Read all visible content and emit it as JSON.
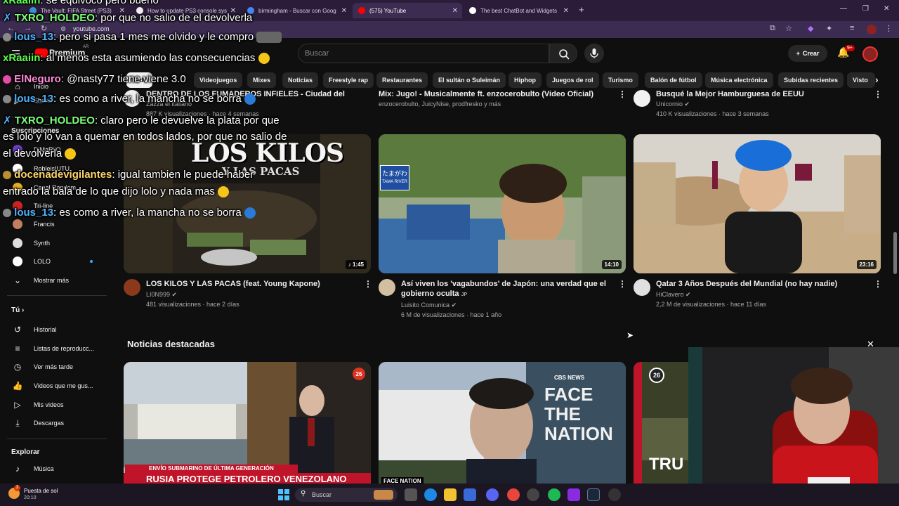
{
  "browser": {
    "tabs": [
      {
        "label": "The Vault: FIFA Street (PS3)",
        "color": "#3a8fd9"
      },
      {
        "label": "How to update PS3 console sys",
        "color": "#eeeeee"
      },
      {
        "label": "birmingham - Buscar con Goog",
        "color": "#4285f4"
      },
      {
        "label": "(575) YouTube",
        "color": "#ff0000"
      },
      {
        "label": "The best ChatBot and Widgets",
        "color": "#ffffff"
      }
    ],
    "new_tab": "+",
    "url": "youtube.com"
  },
  "youtube": {
    "logo_label": "Premium",
    "logo_region": "AR",
    "search_placeholder": "Buscar",
    "create_label": "Crear",
    "notif_count": "9+",
    "chips": [
      "Todo",
      "Videojuegos",
      "Mixes",
      "Noticias",
      "Freestyle rap",
      "Restaurantes",
      "El sultán o Suleimán",
      "Hiphop",
      "Juegos de rol",
      "Turismo",
      "Balón de fútbol",
      "Música electrónica",
      "Subidas recientes",
      "Visto"
    ]
  },
  "sidebar": {
    "top_items": [
      {
        "label": "Inicio",
        "icon": "home-icon"
      },
      {
        "label": "Shorts",
        "icon": "shorts-icon"
      }
    ],
    "subs_title": "Suscripciones",
    "subscriptions": [
      {
        "label": "DjMaRiiO",
        "color": "#6a3fbf"
      },
      {
        "label": "RobleisIUTU",
        "color": "#ffffff"
      },
      {
        "label": "Canal Random",
        "color": "#e0b020"
      },
      {
        "label": "Tri-line",
        "color": "#cc2222"
      },
      {
        "label": "Francis",
        "color": "#c08060"
      },
      {
        "label": "Synth",
        "color": "#dddddd"
      },
      {
        "label": "LOLO",
        "color": "#ffffff"
      }
    ],
    "show_more": "Mostrar más",
    "you_title": "Tú",
    "you_items": [
      {
        "label": "Historial",
        "icon": "history-icon"
      },
      {
        "label": "Listas de reproducc...",
        "icon": "playlist-icon"
      },
      {
        "label": "Ver más tarde",
        "icon": "clock-icon"
      },
      {
        "label": "Videos que me gus...",
        "icon": "like-icon"
      },
      {
        "label": "Mis videos",
        "icon": "video-icon"
      },
      {
        "label": "Descargas",
        "icon": "download-icon"
      }
    ],
    "explore_title": "Explorar",
    "explore_items": [
      {
        "label": "Música",
        "icon": "music-icon"
      }
    ]
  },
  "top_row": [
    {
      "title": "DENTRO DE LOS FUMADEROS INFIELES - Ciudad del Cabo ZA",
      "meta1": "Zazza el italiano",
      "meta2": "887 K visualizaciones · hace 4 semanas"
    },
    {
      "title": "Mix: Jugo! - Musicalmente ft. enzocerobulto (Video Oficial)",
      "meta1": "enzocerobulto, JuicyNise, prodfresko y más",
      "meta2": ""
    },
    {
      "title": "Busqué la Mejor Hamburguesa de EEUU",
      "meta1": "Unicornio",
      "meta2": "410 K visualizaciones · hace 3 semanas"
    }
  ],
  "videos": [
    {
      "title": "LOS KILOS Y LAS PACAS (feat. Young Kapone)",
      "channel": "LI0N999",
      "stats": "481 visualizaciones · hace 2 días",
      "duration": "1:45",
      "thumb_text": "LOS KILOS",
      "thumb_sub": "Y LAS PACAS",
      "avatar_color": "#8a3a1a"
    },
    {
      "title": "Así viven los 'vagabundos' de Japón: una verdad que el gobierno oculta",
      "title_tag": "JP",
      "channel": "Luisito Comunica",
      "stats": "6 M de visualizaciones · hace 1 año",
      "duration": "14:10",
      "sign_text": "たまがわ",
      "sign_sub": "TAMA RIVER",
      "avatar_color": "#d0c0a0"
    },
    {
      "title": "Qatar 3 Años Después del Mundial (no hay nadie)",
      "channel": "HiClavero",
      "stats": "2,2 M de visualizaciones · hace 11 días",
      "duration": "23:16",
      "avatar_color": "#e0e0e0"
    }
  ],
  "news": {
    "title": "Noticias destacadas",
    "cards": [
      {
        "channel_badge": "26",
        "banner": "ENVÍO SUBMARINO DE ÚLTIMA GENERACIÓN",
        "headline": "RUSIA PROTEGE PETROLERO VENEZOLANO"
      },
      {
        "logo": "CBS NEWS",
        "logo_big": "FACE THE NATION",
        "logo_small": "FACE NATION"
      },
      {
        "channel_badge": "26",
        "headline": "TRU"
      }
    ]
  },
  "chat": [
    {
      "user": "xRaaiin",
      "text": ": se equivocó pero bueno",
      "cls": "u1"
    },
    {
      "user": "TXRO_HOLDEO",
      "text": ": por que no salio de el devolverla",
      "cls": "u4"
    },
    {
      "user": "lous_13",
      "text": ": pero si pasa 1 mes me olvido y le compro",
      "cls": "u2"
    },
    {
      "user": "xRaaiin",
      "text": ": al menos esta asumiendo las consecuencias",
      "cls": "u1"
    },
    {
      "user": "ElNeguro",
      "text": ": @nasty77 tiene viene 3.0",
      "cls": "u3"
    },
    {
      "user": "lous_13",
      "text": ": es como a river, la mancha no se borra",
      "cls": "u2"
    },
    {
      "user": "TXRO_HOLDEO",
      "text": ": claro pero le devuelve la plata por que",
      "cls": "u4"
    },
    {
      "user": "",
      "text": "es lolo y lo van a quemar en todos lados, por que no salio de",
      "cls": ""
    },
    {
      "user": "",
      "text": "el devolverla",
      "cls": ""
    },
    {
      "user": "docenadevigilantes",
      "text": ": igual tambien le puede haber",
      "cls": "u4"
    },
    {
      "user": "",
      "text": "entrado la bala de lo que dijo lolo y nada mas",
      "cls": ""
    },
    {
      "user": "lous_13",
      "text": ": es como a river, la mancha no se borra",
      "cls": "u2"
    }
  ],
  "taskbar": {
    "weather_label": "Puesta de sol",
    "weather_time": "20:10",
    "weather_badge": "3",
    "search_placeholder": "Buscar"
  }
}
